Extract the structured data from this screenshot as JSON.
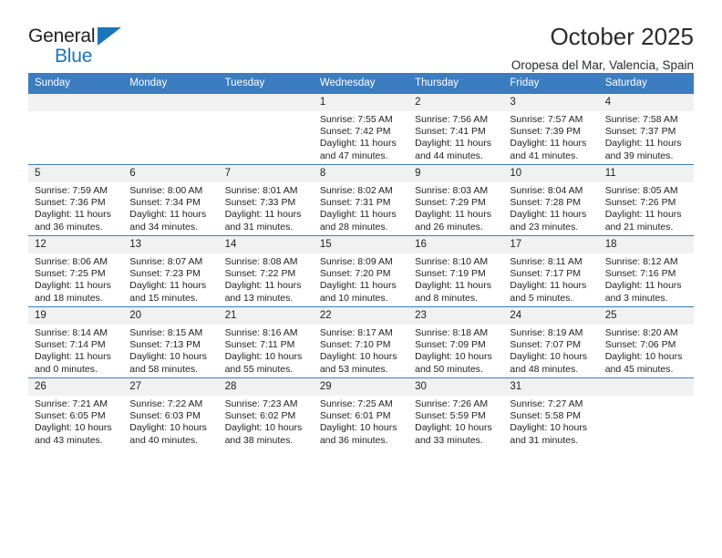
{
  "brand": {
    "name_part1": "General",
    "name_part2": "Blue",
    "triangle_color": "#1b75bb"
  },
  "header": {
    "title": "October 2025",
    "subtitle": "Oropesa del Mar, Valencia, Spain",
    "header_bg_color": "#3b7dc0",
    "daynum_bg_color": "#f1f1f1"
  },
  "weekdays": [
    "Sunday",
    "Monday",
    "Tuesday",
    "Wednesday",
    "Thursday",
    "Friday",
    "Saturday"
  ],
  "labels": {
    "sunrise_prefix": "Sunrise:",
    "sunset_prefix": "Sunset:",
    "daylight_prefix": "Daylight:"
  },
  "weeks": [
    [
      {
        "day": "",
        "empty": true
      },
      {
        "day": "",
        "empty": true
      },
      {
        "day": "",
        "empty": true
      },
      {
        "day": "1",
        "sunrise": "Sunrise: 7:55 AM",
        "sunset": "Sunset: 7:42 PM",
        "daylight": "Daylight: 11 hours and 47 minutes."
      },
      {
        "day": "2",
        "sunrise": "Sunrise: 7:56 AM",
        "sunset": "Sunset: 7:41 PM",
        "daylight": "Daylight: 11 hours and 44 minutes."
      },
      {
        "day": "3",
        "sunrise": "Sunrise: 7:57 AM",
        "sunset": "Sunset: 7:39 PM",
        "daylight": "Daylight: 11 hours and 41 minutes."
      },
      {
        "day": "4",
        "sunrise": "Sunrise: 7:58 AM",
        "sunset": "Sunset: 7:37 PM",
        "daylight": "Daylight: 11 hours and 39 minutes."
      }
    ],
    [
      {
        "day": "5",
        "sunrise": "Sunrise: 7:59 AM",
        "sunset": "Sunset: 7:36 PM",
        "daylight": "Daylight: 11 hours and 36 minutes."
      },
      {
        "day": "6",
        "sunrise": "Sunrise: 8:00 AM",
        "sunset": "Sunset: 7:34 PM",
        "daylight": "Daylight: 11 hours and 34 minutes."
      },
      {
        "day": "7",
        "sunrise": "Sunrise: 8:01 AM",
        "sunset": "Sunset: 7:33 PM",
        "daylight": "Daylight: 11 hours and 31 minutes."
      },
      {
        "day": "8",
        "sunrise": "Sunrise: 8:02 AM",
        "sunset": "Sunset: 7:31 PM",
        "daylight": "Daylight: 11 hours and 28 minutes."
      },
      {
        "day": "9",
        "sunrise": "Sunrise: 8:03 AM",
        "sunset": "Sunset: 7:29 PM",
        "daylight": "Daylight: 11 hours and 26 minutes."
      },
      {
        "day": "10",
        "sunrise": "Sunrise: 8:04 AM",
        "sunset": "Sunset: 7:28 PM",
        "daylight": "Daylight: 11 hours and 23 minutes."
      },
      {
        "day": "11",
        "sunrise": "Sunrise: 8:05 AM",
        "sunset": "Sunset: 7:26 PM",
        "daylight": "Daylight: 11 hours and 21 minutes."
      }
    ],
    [
      {
        "day": "12",
        "sunrise": "Sunrise: 8:06 AM",
        "sunset": "Sunset: 7:25 PM",
        "daylight": "Daylight: 11 hours and 18 minutes."
      },
      {
        "day": "13",
        "sunrise": "Sunrise: 8:07 AM",
        "sunset": "Sunset: 7:23 PM",
        "daylight": "Daylight: 11 hours and 15 minutes."
      },
      {
        "day": "14",
        "sunrise": "Sunrise: 8:08 AM",
        "sunset": "Sunset: 7:22 PM",
        "daylight": "Daylight: 11 hours and 13 minutes."
      },
      {
        "day": "15",
        "sunrise": "Sunrise: 8:09 AM",
        "sunset": "Sunset: 7:20 PM",
        "daylight": "Daylight: 11 hours and 10 minutes."
      },
      {
        "day": "16",
        "sunrise": "Sunrise: 8:10 AM",
        "sunset": "Sunset: 7:19 PM",
        "daylight": "Daylight: 11 hours and 8 minutes."
      },
      {
        "day": "17",
        "sunrise": "Sunrise: 8:11 AM",
        "sunset": "Sunset: 7:17 PM",
        "daylight": "Daylight: 11 hours and 5 minutes."
      },
      {
        "day": "18",
        "sunrise": "Sunrise: 8:12 AM",
        "sunset": "Sunset: 7:16 PM",
        "daylight": "Daylight: 11 hours and 3 minutes."
      }
    ],
    [
      {
        "day": "19",
        "sunrise": "Sunrise: 8:14 AM",
        "sunset": "Sunset: 7:14 PM",
        "daylight": "Daylight: 11 hours and 0 minutes."
      },
      {
        "day": "20",
        "sunrise": "Sunrise: 8:15 AM",
        "sunset": "Sunset: 7:13 PM",
        "daylight": "Daylight: 10 hours and 58 minutes."
      },
      {
        "day": "21",
        "sunrise": "Sunrise: 8:16 AM",
        "sunset": "Sunset: 7:11 PM",
        "daylight": "Daylight: 10 hours and 55 minutes."
      },
      {
        "day": "22",
        "sunrise": "Sunrise: 8:17 AM",
        "sunset": "Sunset: 7:10 PM",
        "daylight": "Daylight: 10 hours and 53 minutes."
      },
      {
        "day": "23",
        "sunrise": "Sunrise: 8:18 AM",
        "sunset": "Sunset: 7:09 PM",
        "daylight": "Daylight: 10 hours and 50 minutes."
      },
      {
        "day": "24",
        "sunrise": "Sunrise: 8:19 AM",
        "sunset": "Sunset: 7:07 PM",
        "daylight": "Daylight: 10 hours and 48 minutes."
      },
      {
        "day": "25",
        "sunrise": "Sunrise: 8:20 AM",
        "sunset": "Sunset: 7:06 PM",
        "daylight": "Daylight: 10 hours and 45 minutes."
      }
    ],
    [
      {
        "day": "26",
        "sunrise": "Sunrise: 7:21 AM",
        "sunset": "Sunset: 6:05 PM",
        "daylight": "Daylight: 10 hours and 43 minutes."
      },
      {
        "day": "27",
        "sunrise": "Sunrise: 7:22 AM",
        "sunset": "Sunset: 6:03 PM",
        "daylight": "Daylight: 10 hours and 40 minutes."
      },
      {
        "day": "28",
        "sunrise": "Sunrise: 7:23 AM",
        "sunset": "Sunset: 6:02 PM",
        "daylight": "Daylight: 10 hours and 38 minutes."
      },
      {
        "day": "29",
        "sunrise": "Sunrise: 7:25 AM",
        "sunset": "Sunset: 6:01 PM",
        "daylight": "Daylight: 10 hours and 36 minutes."
      },
      {
        "day": "30",
        "sunrise": "Sunrise: 7:26 AM",
        "sunset": "Sunset: 5:59 PM",
        "daylight": "Daylight: 10 hours and 33 minutes."
      },
      {
        "day": "31",
        "sunrise": "Sunrise: 7:27 AM",
        "sunset": "Sunset: 5:58 PM",
        "daylight": "Daylight: 10 hours and 31 minutes."
      },
      {
        "day": "",
        "empty": true
      }
    ]
  ]
}
